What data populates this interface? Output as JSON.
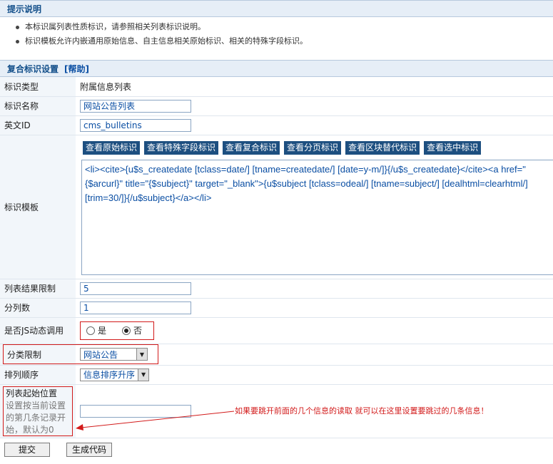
{
  "tips": {
    "title": "提示说明",
    "items": [
      "本标识属列表性质标识，请参照相关列表标识说明。",
      "标识模板允许内嵌通用原始信息、自主信息相关原始标识、相关的特殊字段标识。"
    ]
  },
  "settings": {
    "title": "复合标识设置",
    "help_link": "[帮助]"
  },
  "fields": {
    "tag_type": {
      "label": "标识类型",
      "value": "附属信息列表"
    },
    "tag_name": {
      "label": "标识名称",
      "value": "网站公告列表"
    },
    "english_id": {
      "label": "英文ID",
      "value": "cms_bulletins"
    },
    "template": {
      "label": "标识模板",
      "buttons": [
        "查看原始标识",
        "查看特殊字段标识",
        "查看复合标识",
        "查看分页标识",
        "查看区块替代标识",
        "查看选中标识"
      ],
      "value": "<li><cite>{u$s_createdate [tclass=date/] [tname=createdate/] [date=y-m/]}{/u$s_createdate}</cite><a href=\"{$arcurl}\" title=\"{$subject}\"  target=\"_blank\">{u$subject [tclass=odeal/] [tname=subject/] [dealhtml=clearhtml/] [trim=30/]}{/u$subject}</a></li>"
    },
    "result_limit": {
      "label": "列表结果限制",
      "value": "5"
    },
    "columns": {
      "label": "分列数",
      "value": "1"
    },
    "js_dynamic": {
      "label": "是否JS动态调用",
      "options": [
        "是",
        "否"
      ],
      "selected": "否"
    },
    "category": {
      "label": "分类限制",
      "value": "网站公告"
    },
    "order": {
      "label": "排列顺序",
      "value": "信息排序升序"
    },
    "start_pos": {
      "label": "列表起始位置",
      "hint": "设置按当前设置的第几条记录开始，默认为0",
      "value": ""
    }
  },
  "annotation": "如果要跳开前面的几个信息的读取 就可以在这里设置要跳过的几条信息！",
  "footer": {
    "submit": "提交",
    "generate": "生成代码"
  }
}
